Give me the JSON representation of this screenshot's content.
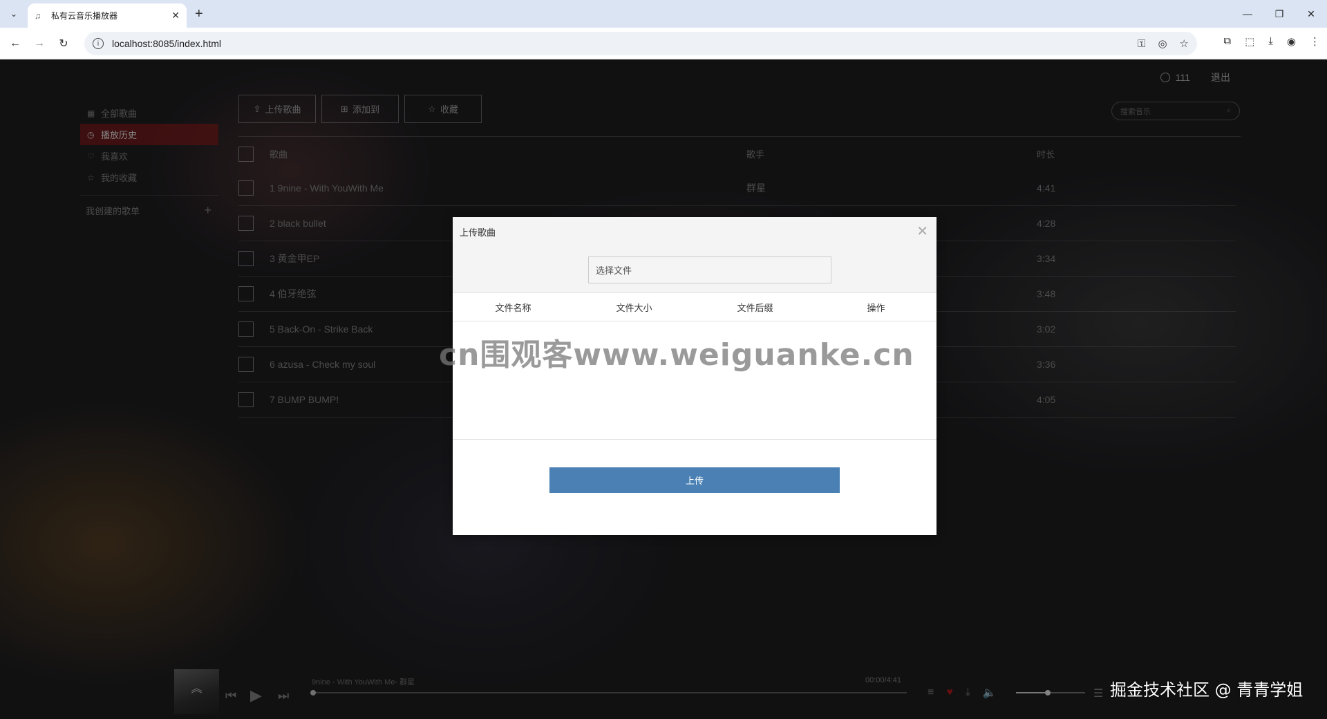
{
  "browser": {
    "tab_title": "私有云音乐播放器",
    "url": "localhost:8085/index.html"
  },
  "user": {
    "name": "111",
    "logout": "退出"
  },
  "sidebar": {
    "items": [
      {
        "label": "全部歌曲",
        "icon": "grid-icon",
        "active": false
      },
      {
        "label": "播放历史",
        "icon": "clock-icon",
        "active": true
      },
      {
        "label": "我喜欢",
        "icon": "heart-icon",
        "active": false
      },
      {
        "label": "我的收藏",
        "icon": "star-icon",
        "active": false
      }
    ],
    "playlist_header": "我创建的歌单"
  },
  "actions": {
    "upload": "上传歌曲",
    "add_to": "添加到",
    "favorite": "收藏"
  },
  "search": {
    "placeholder": "搜索音乐"
  },
  "song_table": {
    "headers": {
      "name": "歌曲",
      "artist": "歌手",
      "duration": "时长"
    },
    "rows": [
      {
        "name": "1 9nine - With YouWith Me",
        "artist": "群星",
        "duration": "4:41"
      },
      {
        "name": "2 black bullet",
        "artist": "",
        "duration": "4:28"
      },
      {
        "name": "3 黄金甲EP",
        "artist": "",
        "duration": "3:34"
      },
      {
        "name": "4 伯牙绝弦",
        "artist": "",
        "duration": "3:48"
      },
      {
        "name": "5 Back-On - Strike Back",
        "artist": "",
        "duration": "3:02"
      },
      {
        "name": "6 azusa - Check my soul",
        "artist": "",
        "duration": "3:36"
      },
      {
        "name": "7 BUMP BUMP!",
        "artist": "",
        "duration": "4:05"
      }
    ]
  },
  "player": {
    "track": "9nine - With YouWith Me- 群星",
    "time": "00:00/4:41",
    "progress": 0,
    "volume": 0.45
  },
  "modal": {
    "title": "上传歌曲",
    "file_input": "选择文件",
    "headers": [
      "文件名称",
      "文件大小",
      "文件后缀",
      "操作"
    ],
    "upload_button": "上传"
  },
  "overlay_text": {
    "watermark": "cn围观客www.weiguanke.cn",
    "credit": "掘金技术社区 @ 青青学姐"
  },
  "colors": {
    "accent_active": "#8c1e1e",
    "upload_button": "#4a80b4",
    "heart": "#b81c1c"
  }
}
